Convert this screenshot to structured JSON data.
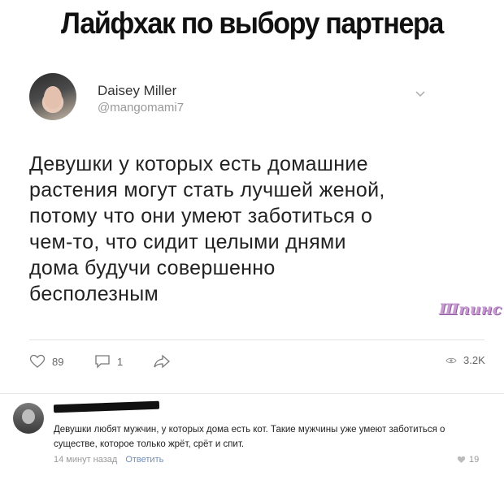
{
  "meme": {
    "title": "Лайфхак по выбору партнера"
  },
  "tweet": {
    "display_name": "Daisey Miller",
    "handle": "@mangomami7",
    "lines": [
      "Девушки у которых есть домашние",
      "растения могут стать лучшей женой,",
      "потому что они умеют заботиться о",
      "чем-то, что сидит целыми днями",
      "дома будучи совершенно",
      "бесполезным"
    ],
    "likes": "89",
    "replies": "1",
    "views": "3.2K",
    "watermark": "Шпинс"
  },
  "comment": {
    "text": "Девушки любят мужчин, у которых дома есть кот. Такие мужчины уже умеют заботиться о существе, которое только жрёт, срёт и спит.",
    "time": "14 минут назад",
    "reply_label": "Ответить",
    "likes": "19"
  },
  "colors": {
    "link": "#6f8fb5",
    "muted": "#999999",
    "watermark": "#c79ad0"
  },
  "icons": [
    "chevron-down-icon",
    "heart-icon",
    "reply-icon",
    "share-icon",
    "eye-icon",
    "like-icon"
  ]
}
